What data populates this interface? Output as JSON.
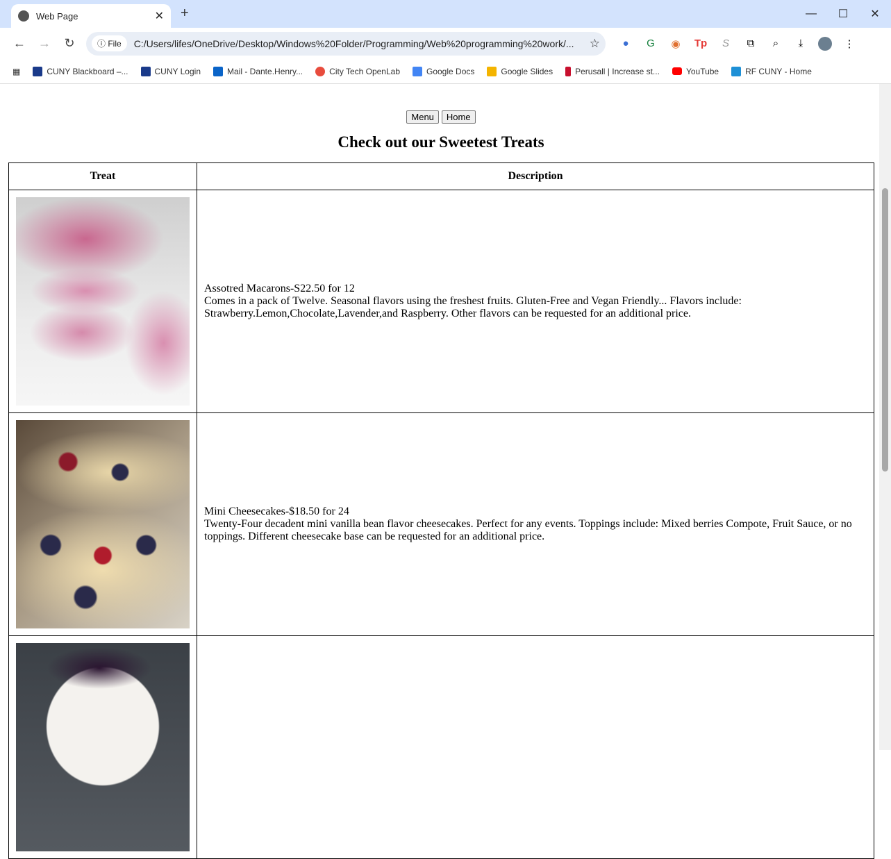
{
  "browser": {
    "tab_title": "Web Page",
    "url_chip": "File",
    "url": "C:/Users/lifes/OneDrive/Desktop/Windows%20Folder/Programming/Web%20programming%20work/...",
    "bookmarks": [
      {
        "label": "CUNY Blackboard –...",
        "color": "#1a3a8a"
      },
      {
        "label": "CUNY Login",
        "color": "#1a3a8a"
      },
      {
        "label": "Mail - Dante.Henry...",
        "color": "#0a64c8"
      },
      {
        "label": "City Tech OpenLab",
        "color": "#e84c3d"
      },
      {
        "label": "Google Docs",
        "color": "#4285f4"
      },
      {
        "label": "Google Slides",
        "color": "#f4b400"
      },
      {
        "label": "Perusall | Increase st...",
        "color": "#c8102e"
      },
      {
        "label": "YouTube",
        "color": "#ff0000"
      },
      {
        "label": "RF CUNY - Home",
        "color": "#1e90d6"
      }
    ]
  },
  "page": {
    "buttons": {
      "menu": "Menu",
      "home": "Home"
    },
    "title": "Check out our Sweetest Treats",
    "table": {
      "headers": [
        "Treat",
        "Description"
      ],
      "rows": [
        {
          "image": "pink macarons",
          "name": "Assotred Macarons-S22.50 for 12",
          "desc": "Comes in a pack of Twelve. Seasonal flavors using the freshest fruits. Gluten-Free and Vegan Friendly... Flavors include: Strawberry.Lemon,Chocolate,Lavender,and Raspberry. Other flavors can be requested for an additional price."
        },
        {
          "image": "mini cheesecakes with berries",
          "name": "Mini Cheesecakes-$18.50 for 24",
          "desc": "Twenty-Four decadent mini vanilla bean flavor cheesecakes. Perfect for any events. Toppings include: Mixed berries Compote, Fruit Sauce, or no toppings. Different cheesecake base can be requested for an additional price."
        },
        {
          "image": "panna cotta with berry sauce",
          "name": "",
          "desc": ""
        }
      ]
    }
  }
}
